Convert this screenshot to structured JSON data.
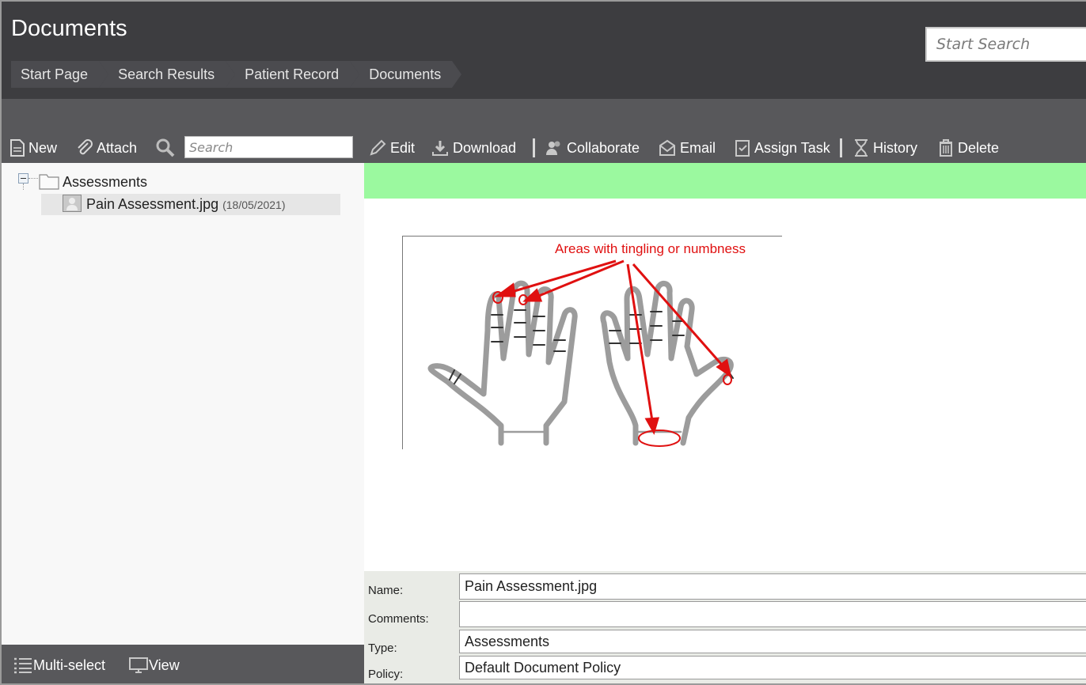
{
  "header": {
    "title": "Documents",
    "search_placeholder": "Start Search",
    "breadcrumb": [
      "Start Page",
      "Search Results",
      "Patient Record",
      "Documents"
    ]
  },
  "toolbar": {
    "new": "New",
    "attach": "Attach",
    "search_placeholder": "Search",
    "edit": "Edit",
    "download": "Download",
    "collaborate": "Collaborate",
    "email": "Email",
    "assign_task": "Assign Task",
    "history": "History",
    "delete": "Delete"
  },
  "tree": {
    "folder": "Assessments",
    "file_name": "Pain Assessment.jpg",
    "file_date": "(18/05/2021)"
  },
  "footer": {
    "multiselect": "Multi-select",
    "view": "View"
  },
  "preview": {
    "caption": "Areas with tingling or numbness",
    "accent_color": "#e01010"
  },
  "properties": {
    "name_label": "Name:",
    "name_value": "Pain Assessment.jpg",
    "comments_label": "Comments:",
    "comments_value": "",
    "type_label": "Type:",
    "type_value": "Assessments",
    "policy_label": "Policy:",
    "policy_value": "Default Document Policy"
  },
  "colors": {
    "header_bg": "#3d3d40",
    "toolbar_bg": "#58585b",
    "status_green": "#9bf99f"
  }
}
